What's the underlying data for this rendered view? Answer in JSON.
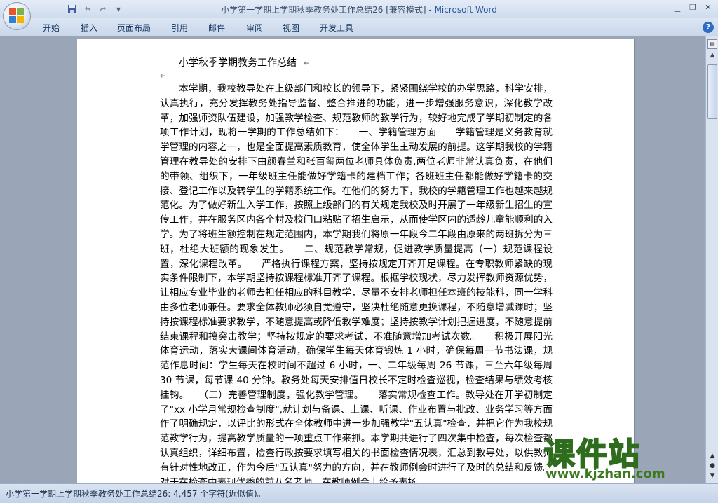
{
  "window": {
    "title_doc": "小学第一学期上学期秋季教务处工作总结26 [兼容模式]",
    "title_separator": " - ",
    "title_app": "Microsoft Word"
  },
  "ribbon": {
    "tabs": [
      "开始",
      "插入",
      "页面布局",
      "引用",
      "邮件",
      "审阅",
      "视图",
      "开发工具"
    ]
  },
  "document": {
    "title": "小学秋季学期教务工作总结",
    "body": "本学期，我校教导处在上级部门和校长的领导下，紧紧围绕学校的办学思路，科学安排，认真执行，充分发挥教务处指导监督、整合推进的功能，进一步增强服务意识，深化教学改革，加强师资队伍建设，加强教学检查、规范教师的教学行为，较好地完成了学期初制定的各项工作计划，现将一学期的工作总结如下：　　一、学籍管理方面　　学籍管理是义务教育就学管理的内容之一，也是全面提高素质教育，使全体学生主动发展的前提。这学期我校的学籍管理在教导处的安排下由颜春兰和张百玺两位老师具体负责,两位老师非常认真负责，在他们的带领、组织下，一年级班主任能做好学籍卡的建档工作；各班班主任都能做好学籍卡的交接、登记工作以及转学生的学籍系统工作。在他们的努力下，我校的学籍管理工作也越来越规范化。为了做好新生入学工作，按照上级部门的有关规定我校及时开展了一年级新生招生的宣传工作，并在服务区内各个村及校门口粘贴了招生启示，从而使学区内的适龄儿童能顺利的入学。为了将班生额控制在规定范围内，本学期我们将原一年段今二年段由原来的两班拆分为三班，杜绝大班额的现象发生。　　二、规范教学常规，促进教学质量提高（一）规范课程设置，深化课程改革。　　严格执行课程方案，坚持按规定开齐开足课程。在专职教师紧缺的现实条件限制下，本学期坚持按课程标准开齐了课程。根据学校现状，尽力发挥教师资源优势，让相应专业毕业的老师去担任相应的科目教学，尽量不安排老师担任本班的技能科，同一学科由多位老师兼任。要求全体教师必须自觉遵守，坚决杜绝随意更换课程，不随意增减课时；坚持按课程标准要求教学，不随意提高或降低教学难度；坚持按教学计划把握进度，不随意提前结束课程和搞突击教学；坚持按规定的要求考试，不准随意增加考试次数。　　积极开展阳光体育运动，落实大课间体育活动，确保学生每天体育锻炼 1 小时，确保每周一节书法课，规范作息时间：学生每天在校时间不超过 6 小时，一、二年级每周 26 节课，三至六年级每周 30 节课，每节课 40 分钟。教务处每天安排值日校长不定时检查巡视，检查结果与绩效考核挂钩。　　（二）完善管理制度，强化教学管理。　　落实常规检查工作。教导处在开学初制定了\"xx 小学月常规检查制度\",就计划与备课、上课、听课、作业布置与批改、业务学习等方面作了明确规定，以评比的形式在全体教师中进一步加强教学\"五认真\"检查，并把它作为我校规范教学行为，提高教学质量的一项重点工作来抓。本学期共进行了四次集中检查，每次检查都认真组织，详细布置，检查行政按要求填写相关的书面检查情况表，汇总到教导处，以供教师有针对性地改正，作为今后\"五认真\"努力的方向，并在教师例会时进行了及时的总结和反馈。对于在检查中表现优秀的前八名老师，在教师例会上给予表扬"
  },
  "status_bar": {
    "text": "小学第一学期上学期秋季教务处工作总结26: 4,457 个字符(近似值)。"
  },
  "watermark": {
    "main": "课件站",
    "url": "www.kjzhan.com"
  },
  "icons": {
    "office_button": "office-logo-icon",
    "save": "save-icon",
    "undo": "undo-icon",
    "redo": "redo-icon",
    "customize": "customize-qat-icon",
    "minimize": "minimize-icon",
    "restore": "restore-icon",
    "close": "close-icon",
    "help": "help-icon"
  }
}
